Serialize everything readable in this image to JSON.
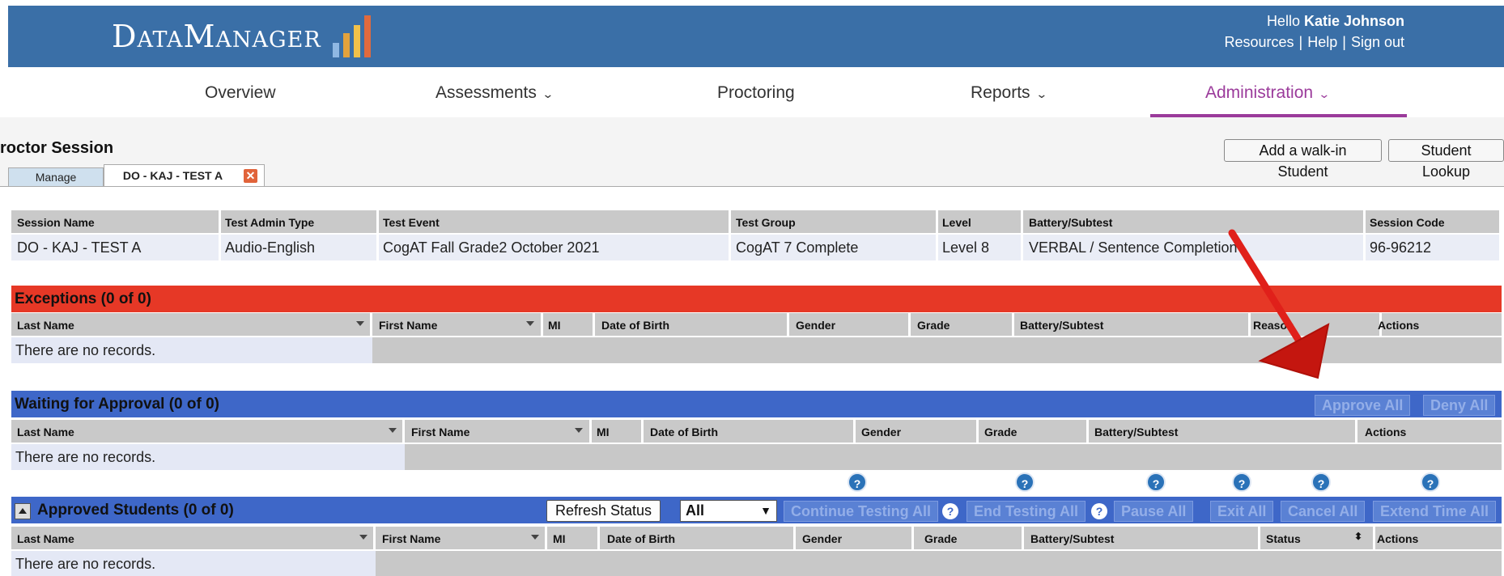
{
  "header": {
    "logo_text": "DataManager",
    "logo_bar_colors": [
      "#8fb8e3",
      "#e3a23c",
      "#f1c14a",
      "#e06a3e",
      "#d9463a"
    ],
    "greeting_prefix": "Hello",
    "user_name": "Katie Johnson",
    "links": [
      "Resources",
      "Help",
      "Sign out"
    ],
    "color": "#3a6fa7"
  },
  "nav": {
    "items": [
      {
        "label": "Overview"
      },
      {
        "label": "Assessments"
      },
      {
        "label": "Proctoring"
      },
      {
        "label": "Reports"
      },
      {
        "label": "Administration"
      }
    ],
    "active_color": "#9b3b9b"
  },
  "page": {
    "title": "roctor Session",
    "buttons": {
      "walk_in": "Add a walk-in Student",
      "lookup": "Student Lookup"
    },
    "tabs": {
      "manage": "Manage",
      "session": "DO - KAJ - TEST A"
    }
  },
  "session_table": {
    "headers": [
      "Session Name",
      "Test Admin Type",
      "Test Event",
      "Test Group",
      "Level",
      "Battery/Subtest",
      "Session Code"
    ],
    "row": [
      "DO - KAJ - TEST A",
      "Audio-English",
      "CogAT Fall Grade2 October 2021",
      "CogAT 7 Complete",
      "Level 8",
      "VERBAL / Sentence Completion",
      "96-96212"
    ]
  },
  "exceptions": {
    "title": "Exceptions  (0 of 0)",
    "headers": [
      "Last Name",
      "First Name",
      "MI",
      "Date of Birth",
      "Gender",
      "Grade",
      "Battery/Subtest",
      "Reason",
      "Actions"
    ],
    "empty": "There are no records.",
    "color": "#e63826"
  },
  "waiting": {
    "title": "Waiting for Approval (0 of 0)",
    "buttons": {
      "approve_all": "Approve All",
      "deny_all": "Deny All"
    },
    "headers": [
      "Last Name",
      "First Name",
      "MI",
      "Date of Birth",
      "Gender",
      "Grade",
      "Battery/Subtest",
      "Actions"
    ],
    "empty": "There are no records.",
    "color": "#3e67c8"
  },
  "approved": {
    "title": "Approved Students (0 of 0)",
    "buttons": {
      "refresh": "Refresh Status",
      "continue_all": "Continue Testing All",
      "end_all": "End Testing All",
      "pause_all": "Pause All",
      "exit_all": "Exit All",
      "cancel_all": "Cancel All",
      "extend_all": "Extend Time All"
    },
    "filter_value": "All",
    "help_glyph": "?",
    "headers": [
      "Last Name",
      "First Name",
      "MI",
      "Date of Birth",
      "Gender",
      "Grade",
      "Battery/Subtest",
      "Status",
      "Actions"
    ],
    "empty": "There are no records."
  },
  "annotation": {
    "arrow_color": "#e0201a"
  }
}
